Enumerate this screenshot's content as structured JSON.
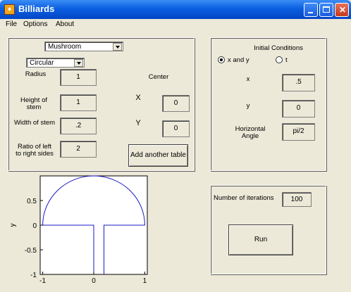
{
  "window": {
    "title": "Billiards",
    "icon": "matlab-icon"
  },
  "menu": [
    "File",
    "Options",
    "About"
  ],
  "table": {
    "type_value": "Mushroom",
    "cap_shape_value": "Circular",
    "labels": {
      "radius": "Radius",
      "height_of_stem": [
        "Height of",
        "stem"
      ],
      "width_of_stem": "Width of stem",
      "ratio": [
        "Ratio of left",
        "to right sides"
      ],
      "center": "Center",
      "x": "X",
      "y": "Y"
    },
    "values": {
      "radius": "1",
      "height_of_stem": "1",
      "width_of_stem": ".2",
      "ratio": "2",
      "center_x": "0",
      "center_y": "0"
    },
    "add_button": "Add another table"
  },
  "initial_conditions": {
    "title": "Initial Conditions",
    "radio_xy": "x and y",
    "radio_t": "t",
    "selected": "xy",
    "labels": {
      "x": "x",
      "y": "y",
      "angle": [
        "Horizontal",
        "Angle"
      ]
    },
    "values": {
      "x": ".5",
      "y": "0",
      "angle": "pi/2"
    }
  },
  "run_panel": {
    "iterations_label": "Number of iterations",
    "iterations_value": "100",
    "run_label": "Run"
  },
  "chart_data": {
    "type": "line",
    "ylabel": "y",
    "xlim": [
      -1.05,
      1.05
    ],
    "ylim": [
      -1,
      1
    ],
    "xticks": [
      "-1",
      "0",
      "1"
    ],
    "yticks": [
      "0.5",
      "0",
      "-0.5",
      "-1"
    ],
    "series": [
      {
        "description": "semicircle cap",
        "radius": 1,
        "center": [
          0,
          0
        ]
      },
      {
        "description": "stem",
        "x": [
          0,
          0.2
        ],
        "y_bottom": -1,
        "y_top": 0
      }
    ]
  }
}
